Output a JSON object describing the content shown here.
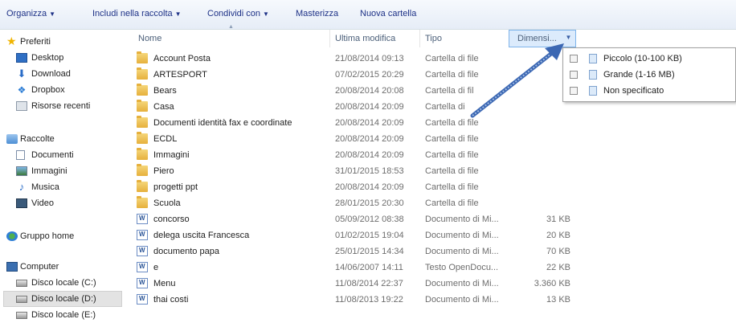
{
  "toolbar": {
    "organize": "Organizza",
    "include": "Includi nella raccolta",
    "share": "Condividi con",
    "burn": "Masterizza",
    "new_folder": "Nuova cartella"
  },
  "nav": {
    "favorites": "Preferiti",
    "desktop": "Desktop",
    "download": "Download",
    "dropbox": "Dropbox",
    "recent": "Risorse recenti",
    "libraries": "Raccolte",
    "documents": "Documenti",
    "images": "Immagini",
    "music": "Musica",
    "video": "Video",
    "homegroup": "Gruppo home",
    "computer": "Computer",
    "disk_c": "Disco locale (C:)",
    "disk_d": "Disco locale (D:)",
    "disk_e": "Disco locale (E:)"
  },
  "columns": {
    "name": "Nome",
    "modified": "Ultima modifica",
    "type": "Tipo",
    "size": "Dimensi..."
  },
  "files": [
    {
      "name": "Account Posta",
      "date": "21/08/2014 09:13",
      "type": "Cartella di file",
      "size": "",
      "icon": "folder"
    },
    {
      "name": "ARTESPORT",
      "date": "07/02/2015 20:29",
      "type": "Cartella di file",
      "size": "",
      "icon": "folder"
    },
    {
      "name": "Bears",
      "date": "20/08/2014 20:08",
      "type": "Cartella di fil",
      "size": "",
      "icon": "folder"
    },
    {
      "name": "Casa",
      "date": "20/08/2014 20:09",
      "type": "Cartella di",
      "size": "",
      "icon": "folder"
    },
    {
      "name": "Documenti identità fax e coordinate",
      "date": "20/08/2014 20:09",
      "type": "Cartella di file",
      "size": "",
      "icon": "folder"
    },
    {
      "name": "ECDL",
      "date": "20/08/2014 20:09",
      "type": "Cartella di file",
      "size": "",
      "icon": "folder"
    },
    {
      "name": "Immagini",
      "date": "20/08/2014 20:09",
      "type": "Cartella di file",
      "size": "",
      "icon": "folder"
    },
    {
      "name": "Piero",
      "date": "31/01/2015 18:53",
      "type": "Cartella di file",
      "size": "",
      "icon": "folder"
    },
    {
      "name": "progetti ppt",
      "date": "20/08/2014 20:09",
      "type": "Cartella di file",
      "size": "",
      "icon": "folder"
    },
    {
      "name": "Scuola",
      "date": "28/01/2015 20:30",
      "type": "Cartella di file",
      "size": "",
      "icon": "folder"
    },
    {
      "name": "concorso",
      "date": "05/09/2012 08:38",
      "type": "Documento di Mi...",
      "size": "31 KB",
      "icon": "doc"
    },
    {
      "name": "delega uscita Francesca",
      "date": "01/02/2015 19:04",
      "type": "Documento di Mi...",
      "size": "20 KB",
      "icon": "doc"
    },
    {
      "name": "documento papa",
      "date": "25/01/2015 14:34",
      "type": "Documento di Mi...",
      "size": "70 KB",
      "icon": "doc"
    },
    {
      "name": "e",
      "date": "14/06/2007 14:11",
      "type": "Testo OpenDocu...",
      "size": "22 KB",
      "icon": "doc"
    },
    {
      "name": "Menu",
      "date": "11/08/2014 22:37",
      "type": "Documento di Mi...",
      "size": "3.360 KB",
      "icon": "doc"
    },
    {
      "name": "thai costi",
      "date": "11/08/2013 19:22",
      "type": "Documento di Mi...",
      "size": "13 KB",
      "icon": "doc"
    }
  ],
  "filters": {
    "small": "Piccolo (10-100 KB)",
    "large": "Grande (1-16 MB)",
    "unspecified": "Non specificato"
  }
}
